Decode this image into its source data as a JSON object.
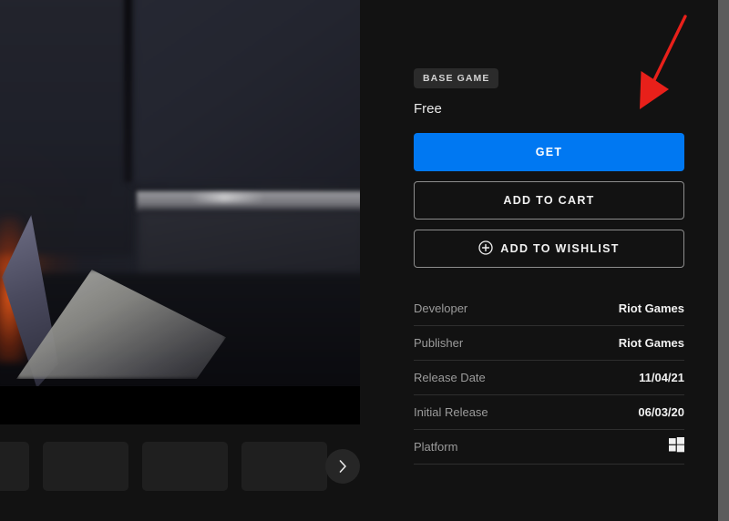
{
  "gallery": {
    "hero_alt": "game-screenshot",
    "thumbnails": [
      {
        "name": "thumbnail-1"
      },
      {
        "name": "thumbnail-2"
      },
      {
        "name": "thumbnail-3"
      }
    ],
    "next_icon": "chevron-right-icon"
  },
  "purchase": {
    "badge": "BASE GAME",
    "price": "Free",
    "get_label": "GET",
    "cart_label": "ADD TO CART",
    "wishlist_label": "ADD TO WISHLIST",
    "wishlist_icon": "plus-circle-icon",
    "accent_color": "#0078f2"
  },
  "details": {
    "rows": [
      {
        "label": "Developer",
        "value": "Riot Games"
      },
      {
        "label": "Publisher",
        "value": "Riot Games"
      },
      {
        "label": "Release Date",
        "value": "11/04/21"
      },
      {
        "label": "Initial Release",
        "value": "06/03/20"
      },
      {
        "label": "Platform",
        "value": "",
        "icon": "windows-icon"
      }
    ]
  },
  "annotation": {
    "type": "arrow",
    "color": "#e8201a",
    "points_to": "GET"
  }
}
